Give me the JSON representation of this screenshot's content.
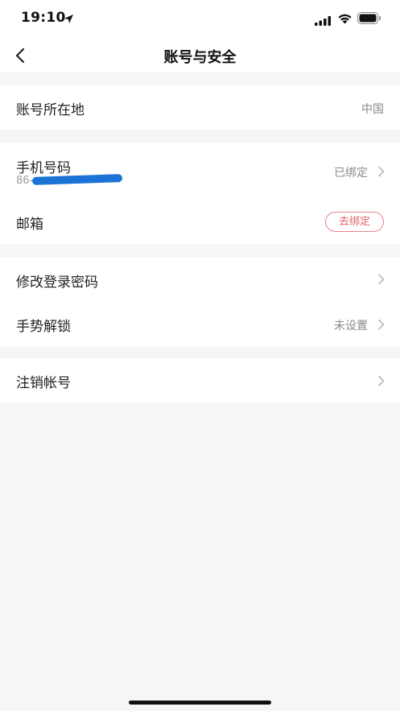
{
  "status_bar": {
    "time": "19:10"
  },
  "nav": {
    "title": "账号与安全"
  },
  "sections": {
    "location": {
      "label": "账号所在地",
      "value": "中国"
    },
    "phone": {
      "label": "手机号码",
      "sub_prefix": "86-",
      "value": "已绑定"
    },
    "email": {
      "label": "邮箱",
      "button": "去绑定"
    },
    "password": {
      "label": "修改登录密码"
    },
    "gesture": {
      "label": "手势解锁",
      "value": "未设置"
    },
    "cancel_account": {
      "label": "注销帐号"
    }
  },
  "colors": {
    "background": "#f6f6f6",
    "card": "#ffffff",
    "accent_red": "#e2636e",
    "redaction_blue": "#1b73d6"
  },
  "icons": [
    "location-arrow-icon",
    "signal-icon",
    "wifi-icon",
    "battery-icon",
    "back-icon",
    "chevron-right-icon"
  ]
}
